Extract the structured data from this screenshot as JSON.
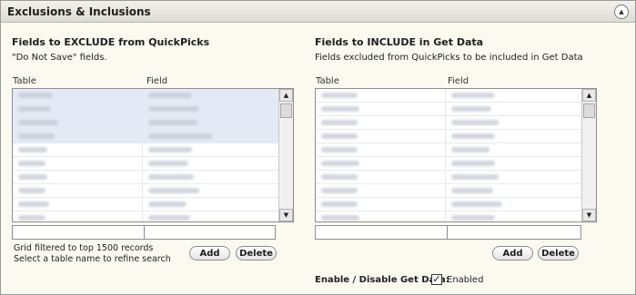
{
  "panel": {
    "title": "Exclusions & Inclusions",
    "collapse_icon_glyph": "▲"
  },
  "exclude": {
    "title": "Fields to EXCLUDE from QuickPicks",
    "subtitle": "\"Do Not Save\" fields.",
    "columns": {
      "table": "Table",
      "field": "Field"
    },
    "row_count": 10,
    "table_filter_value": "",
    "field_filter_value": "",
    "note_line1": "Grid filtered to top 1500 records",
    "note_line2": "Select a table name to refine search",
    "add_label": "Add",
    "delete_label": "Delete"
  },
  "include": {
    "title": "Fields to INCLUDE in Get Data",
    "subtitle": "Fields excluded from QuickPicks to be included in Get Data",
    "columns": {
      "table": "Table",
      "field": "Field"
    },
    "row_count": 10,
    "table_filter_value": "",
    "field_filter_value": "",
    "add_label": "Add",
    "delete_label": "Delete"
  },
  "get_data": {
    "toggle_label": "Enable / Disable Get Data:",
    "checked": true,
    "check_glyph": "✓",
    "checkbox_label": "Enabled"
  },
  "scrollbar": {
    "up_glyph": "▲",
    "down_glyph": "▼"
  },
  "colors": {
    "panel_bg": "#fbfaf0",
    "header_bg": "#dcdbd4",
    "selected_row": "#e4eaf5"
  }
}
